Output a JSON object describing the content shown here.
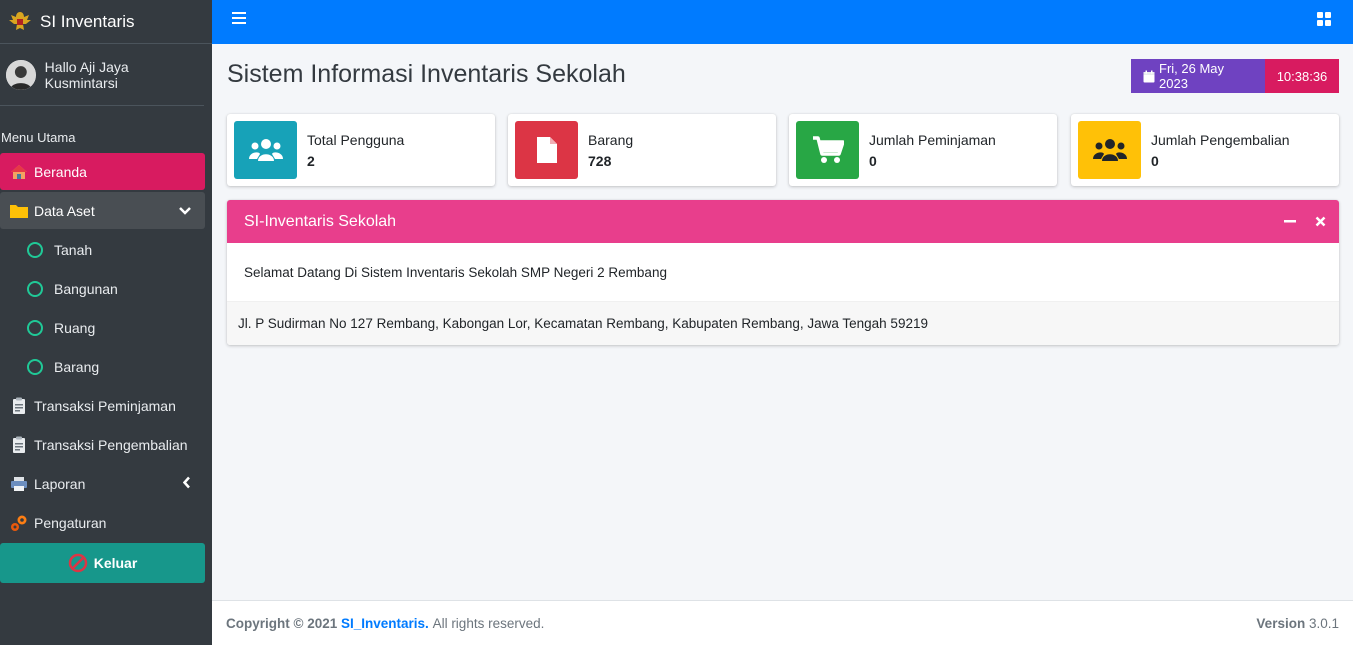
{
  "brand": {
    "title": "SI Inventaris"
  },
  "user": {
    "greeting": "Hallo Aji Jaya Kusmintarsi"
  },
  "sidebar": {
    "header": "Menu Utama",
    "items": [
      {
        "label": "Beranda",
        "icon": "home-icon"
      },
      {
        "label": "Data Aset",
        "icon": "folder-icon"
      },
      {
        "label": "Tanah",
        "icon": "circle-icon"
      },
      {
        "label": "Bangunan",
        "icon": "circle-icon"
      },
      {
        "label": "Ruang",
        "icon": "circle-icon"
      },
      {
        "label": "Barang",
        "icon": "circle-icon"
      },
      {
        "label": "Transaksi Peminjaman",
        "icon": "clipboard-icon"
      },
      {
        "label": "Transaksi Pengembalian",
        "icon": "clipboard-icon"
      },
      {
        "label": "Laporan",
        "icon": "printer-icon"
      },
      {
        "label": "Pengaturan",
        "icon": "gears-icon"
      }
    ],
    "logout": "Keluar"
  },
  "header": {
    "title": "Sistem Informasi Inventaris Sekolah",
    "date": "Fri, 26 May 2023",
    "time": "10:38:36"
  },
  "stats": [
    {
      "label": "Total Pengguna",
      "value": "2",
      "color": "#17a2b8",
      "icon": "users-icon"
    },
    {
      "label": "Barang",
      "value": "728",
      "color": "#dc3545",
      "icon": "file-icon"
    },
    {
      "label": "Jumlah Peminjaman",
      "value": "0",
      "color": "#28a745",
      "icon": "cart-icon"
    },
    {
      "label": "Jumlah Pengembalian",
      "value": "0",
      "color": "#ffc107",
      "icon": "users-icon"
    }
  ],
  "card": {
    "title": "SI-Inventaris Sekolah",
    "body": "Selamat Datang Di Sistem Inventaris Sekolah SMP Negeri 2 Rembang",
    "footer": "Jl. P Sudirman No 127 Rembang, Kabongan Lor, Kecamatan Rembang, Kabupaten Rembang, Jawa Tengah 59219"
  },
  "footer": {
    "copyright": "Copyright © 2021",
    "brand": "SI_Inventaris.",
    "rights": "All rights reserved.",
    "version_label": "Version",
    "version": "3.0.1"
  },
  "colors": {
    "primary": "#007bff",
    "sidebar": "#343a40",
    "active": "#d81b60",
    "card_header": "#e83e8c",
    "date": "#6f42c1",
    "logout": "#17978b"
  }
}
